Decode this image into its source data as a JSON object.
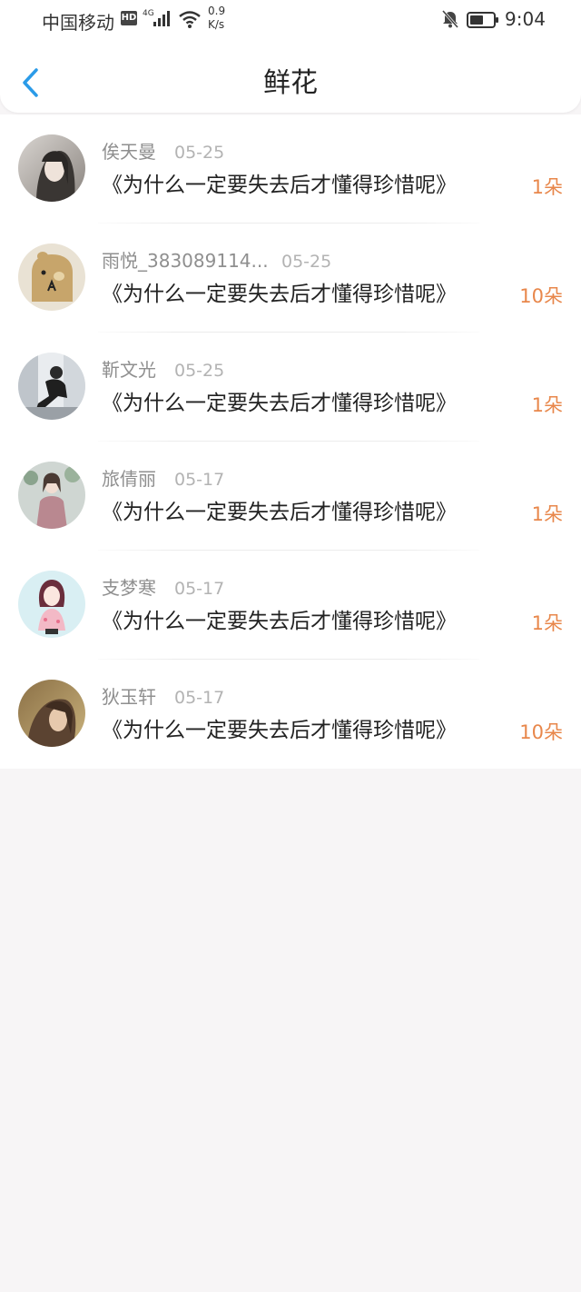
{
  "status_bar": {
    "carrier": "中国移动",
    "hd_badge": "HD",
    "network": "4G",
    "speed_value": "0.9",
    "speed_unit": "K/s",
    "time": "9:04"
  },
  "header": {
    "title": "鲜花",
    "back_icon": "chevron-left-icon",
    "accent_color": "#2b9be8"
  },
  "list": {
    "count_color": "#e8874b",
    "items": [
      {
        "name": "俟天曼",
        "date": "05-25",
        "text": "《为什么一定要失去后才懂得珍惜呢》",
        "count": "1朵"
      },
      {
        "name": "雨悦_383089114...",
        "date": "05-25",
        "text": "《为什么一定要失去后才懂得珍惜呢》",
        "count": "10朵"
      },
      {
        "name": "靳文光",
        "date": "05-25",
        "text": "《为什么一定要失去后才懂得珍惜呢》",
        "count": "1朵"
      },
      {
        "name": "旅倩丽",
        "date": "05-17",
        "text": "《为什么一定要失去后才懂得珍惜呢》",
        "count": "1朵"
      },
      {
        "name": "支梦寒",
        "date": "05-17",
        "text": "《为什么一定要失去后才懂得珍惜呢》",
        "count": "1朵"
      },
      {
        "name": "狄玉轩",
        "date": "05-17",
        "text": "《为什么一定要失去后才懂得珍惜呢》",
        "count": "10朵"
      }
    ]
  }
}
